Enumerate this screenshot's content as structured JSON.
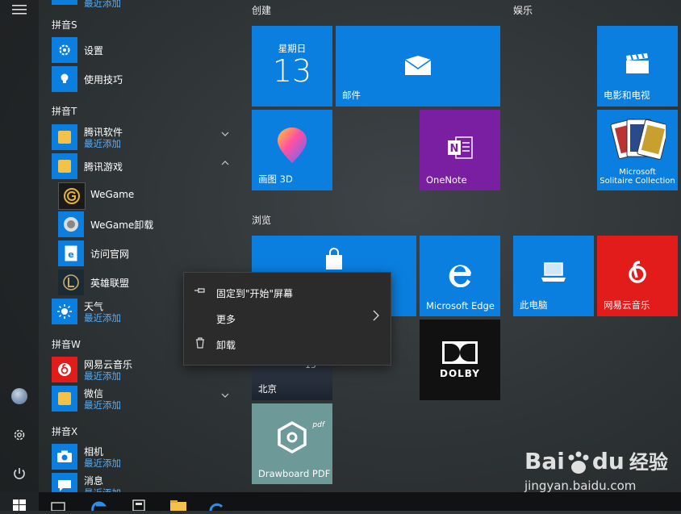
{
  "rail": {
    "menu_icon": "hamburger-icon",
    "settings_icon": "gear-icon",
    "power_icon": "power-icon"
  },
  "app_list": {
    "sections": [
      {
        "header": "拼音S"
      },
      {
        "header": "拼音T"
      },
      {
        "header": "拼音W"
      },
      {
        "header": "拼音X"
      }
    ],
    "items": {
      "settings": {
        "name": "设置"
      },
      "tips": {
        "name": "使用技巧"
      },
      "tencent_soft": {
        "name": "腾讯软件",
        "sub": "最近添加"
      },
      "tencent_games": {
        "name": "腾讯游戏"
      },
      "wegame": {
        "name": "WeGame"
      },
      "wegame_uninstall": {
        "name": "WeGame卸载"
      },
      "official_site": {
        "name": "访问官网"
      },
      "lol": {
        "name": "英雄联盟"
      },
      "weather": {
        "name": "天气",
        "sub": "最近添加"
      },
      "netease_music": {
        "name": "网易云音乐",
        "sub": "最近添加"
      },
      "wechat": {
        "name": "微信",
        "sub": "最近添加"
      },
      "camera": {
        "name": "相机",
        "sub": "最近添加"
      },
      "messages": {
        "name": "消息",
        "sub": "最近添加"
      }
    }
  },
  "groups": {
    "create": "创建",
    "entertainment": "娱乐",
    "browse": "浏览"
  },
  "tiles": {
    "calendar": {
      "day": "星期日",
      "date": "13"
    },
    "mail": {
      "label": "邮件"
    },
    "paint3d": {
      "label": "画图 3D"
    },
    "onenote": {
      "label": "OneNote"
    },
    "movies": {
      "label": "电影和电视"
    },
    "solitaire": {
      "label_line1": "Microsoft",
      "label_line2": "Solitaire Collection"
    },
    "edge": {
      "label": "Microsoft Edge"
    },
    "this_pc": {
      "label": "此电脑"
    },
    "netease": {
      "label": "网易云音乐"
    },
    "weather": {
      "label": "北京",
      "small": "15"
    },
    "dolby": {
      "label": "DOLBY"
    },
    "drawboard": {
      "label": "Drawboard PDF",
      "tag": "pdf"
    }
  },
  "context_menu": {
    "pin": "固定到\"开始\"屏幕",
    "more": "更多",
    "uninstall": "卸载"
  },
  "watermark": {
    "brand": "Bai",
    "brand2": "du",
    "cn": "经验",
    "url": "jingyan.baidu.com"
  },
  "colors": {
    "tile_blue": "#0a7fe0",
    "onenote_purple": "#7a1fa2",
    "netease_red": "#e21b1b",
    "dolby_black": "#111111",
    "drawboard_teal": "#6d9a98"
  }
}
